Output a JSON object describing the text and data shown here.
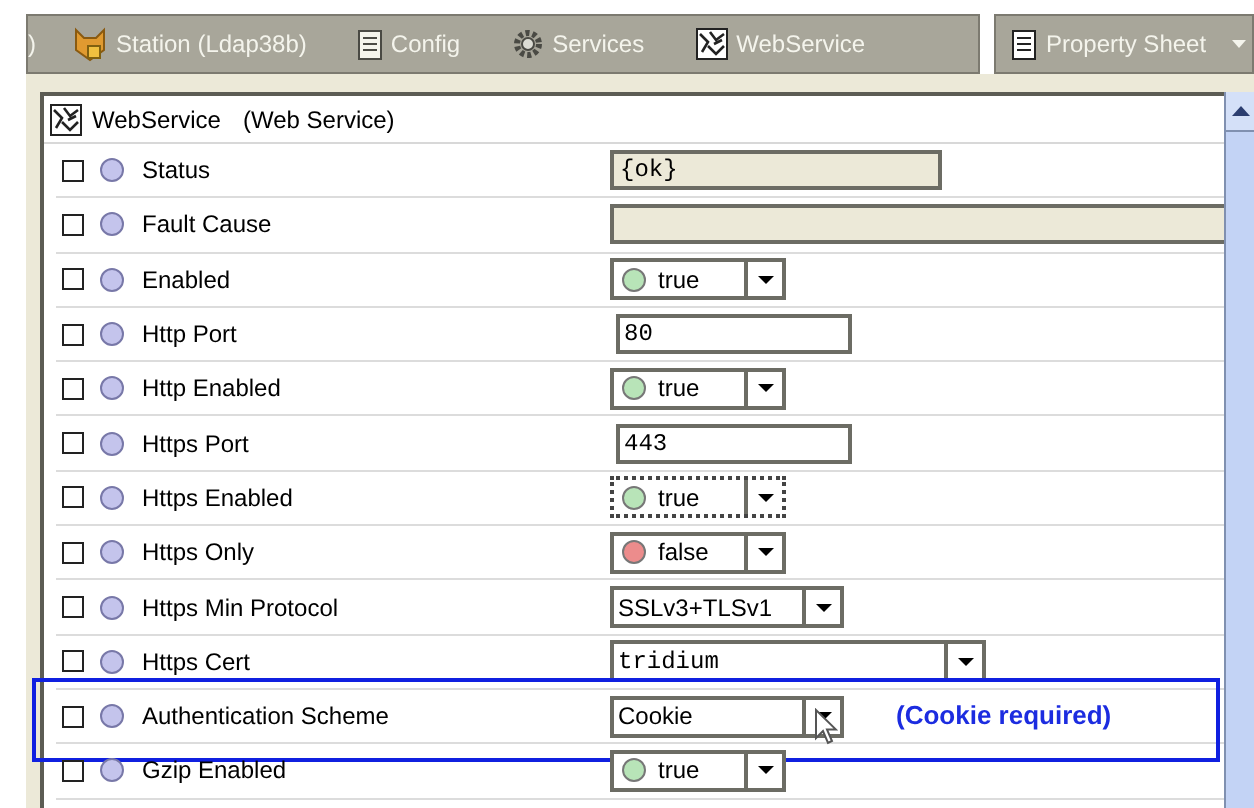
{
  "nav_bar": {
    "items": [
      {
        "label": ")",
        "kind": "cut"
      },
      {
        "label": "Station (Ldap38b)",
        "kind": "station"
      },
      {
        "label": "Config",
        "kind": "config"
      },
      {
        "label": "Services",
        "kind": "services"
      },
      {
        "label": "WebService",
        "kind": "webservice"
      }
    ],
    "view_selector": {
      "label": "Property Sheet"
    }
  },
  "sheet": {
    "title": "WebService",
    "type": "(Web Service)",
    "rows": [
      {
        "label": "Status",
        "checked": false,
        "kind": "readonly",
        "value": "{ok}"
      },
      {
        "label": "Fault Cause",
        "checked": false,
        "kind": "readonly"
      },
      {
        "label": "Enabled",
        "checked": false,
        "kind": "bool",
        "value": "true",
        "color": "#b8e4b8"
      },
      {
        "label": "Http Port",
        "checked": false,
        "kind": "text",
        "value": "80"
      },
      {
        "label": "Http Enabled",
        "checked": false,
        "kind": "bool",
        "value": "true",
        "color": "#b8e4b8"
      },
      {
        "label": "Https Port",
        "checked": false,
        "kind": "text",
        "value": "443"
      },
      {
        "label": "Https Enabled",
        "checked": false,
        "kind": "bool",
        "value": "true",
        "color": "#b8e4b8",
        "focused": true
      },
      {
        "label": "Https Only",
        "checked": false,
        "kind": "bool",
        "value": "false",
        "color": "#ec8c8c"
      },
      {
        "label": "Https Min Protocol",
        "checked": false,
        "kind": "enum",
        "value": "SSLv3+TLSv1"
      },
      {
        "label": "Https Cert",
        "checked": false,
        "kind": "cert",
        "value": "tridium"
      },
      {
        "label": "Authentication Scheme",
        "checked": false,
        "kind": "enum",
        "value": "Cookie",
        "highlighted": true,
        "note": "(Cookie required)"
      },
      {
        "label": "Gzip Enabled",
        "checked": false,
        "kind": "bool",
        "value": "true",
        "color": "#b8e4b8"
      }
    ]
  }
}
